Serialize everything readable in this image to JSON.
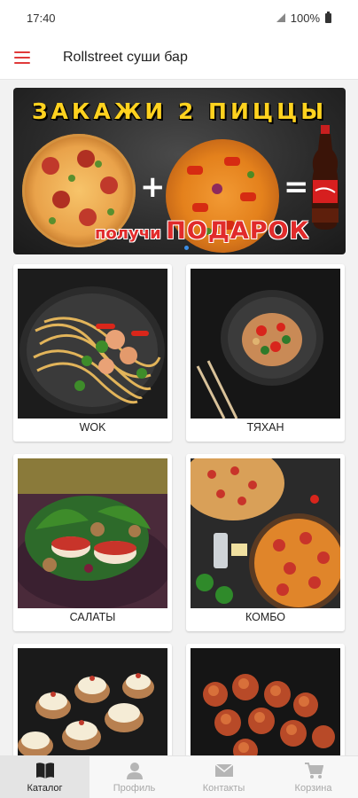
{
  "status_bar": {
    "time": "17:40",
    "battery": "100%"
  },
  "app_bar": {
    "title": "Rollstreet суши бар",
    "menu_icon": "hamburger-menu-icon",
    "accent": "#e03a3a"
  },
  "banner": {
    "title": "ЗАКАЖИ 2 ПИЦЦЫ",
    "gift_small": "получи",
    "gift_big": "ПОДАРОК"
  },
  "categories": [
    {
      "label": "WOK"
    },
    {
      "label": "ТЯХАН"
    },
    {
      "label": "САЛАТЫ"
    },
    {
      "label": "КОМБО"
    },
    {
      "label": ""
    },
    {
      "label": ""
    }
  ],
  "bottom_nav": {
    "items": [
      {
        "label": "Каталог",
        "icon": "book-icon",
        "active": true
      },
      {
        "label": "Профиль",
        "icon": "user-icon",
        "active": false
      },
      {
        "label": "Контакты",
        "icon": "envelope-icon",
        "active": false
      },
      {
        "label": "Корзина",
        "icon": "cart-icon",
        "active": false
      }
    ]
  }
}
